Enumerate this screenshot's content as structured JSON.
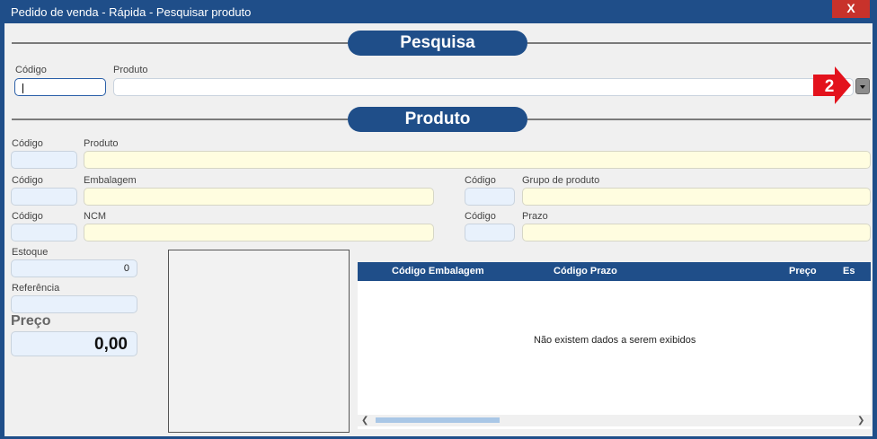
{
  "window": {
    "title": "Pedido de venda - Rápida - Pesquisar produto",
    "close_label": "X"
  },
  "pesquisa": {
    "title": "Pesquisa",
    "codigo_label": "Código",
    "produto_label": "Produto",
    "codigo_value": "",
    "produto_value": "",
    "badge_number": "2"
  },
  "produto": {
    "title": "Produto",
    "row1": {
      "codigo_label": "Código",
      "produto_label": "Produto"
    },
    "row2": {
      "codigo_label": "Código",
      "embalagem_label": "Embalagem",
      "codigo2_label": "Código",
      "grupo_label": "Grupo de produto"
    },
    "row3": {
      "codigo_label": "Código",
      "ncm_label": "NCM",
      "codigo2_label": "Código",
      "prazo_label": "Prazo"
    },
    "estoque_label": "Estoque",
    "estoque_value": "0",
    "referencia_label": "Referência",
    "preco_label": "Preço",
    "preco_value": "0,00"
  },
  "grid": {
    "columns": [
      "Código Embalagem",
      "Código Prazo",
      "Preço",
      "Es"
    ],
    "empty_message": "Não existem dados a serem exibidos"
  },
  "colors": {
    "accent": "#1f4e89",
    "close": "#c8322b",
    "badge": "#e3121c"
  },
  "icons": {
    "close": "close-icon",
    "dropdown": "chevron-down-icon",
    "badge": "arrow-badge-icon"
  }
}
